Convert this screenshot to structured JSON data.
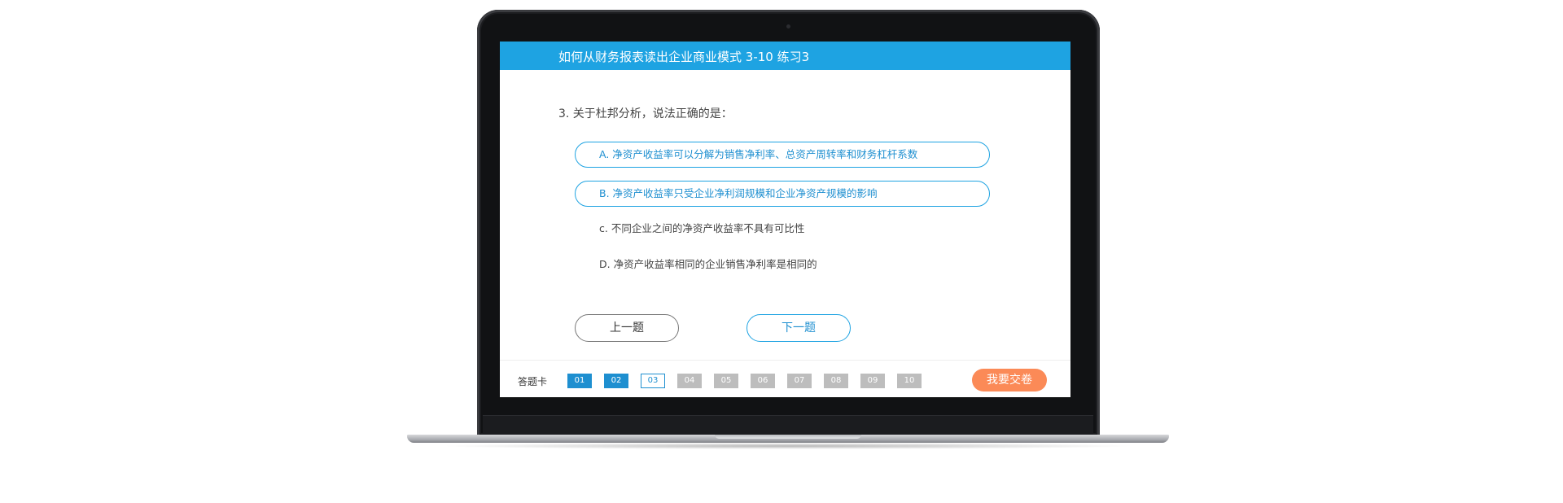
{
  "header": {
    "title": "如何从财务报表读出企业商业模式 3-10 练习3"
  },
  "question": {
    "text": "3. 关于杜邦分析，说法正确的是："
  },
  "options": [
    {
      "label": "A. 净资产收益率可以分解为销售净利率、总资产周转率和财务杠杆系数",
      "selected": true
    },
    {
      "label": "B. 净资产收益率只受企业净利润规模和企业净资产规模的影响",
      "selected": true
    },
    {
      "label": "c. 不同企业之间的净资产收益率不具有可比性",
      "selected": false
    },
    {
      "label": "D. 净资产收益率相同的企业销售净利率是相同的",
      "selected": false
    }
  ],
  "navigation": {
    "prev_label": "上一题",
    "next_label": "下一题"
  },
  "answer_card": {
    "label": "答题卡",
    "items": [
      {
        "num": "01",
        "state": "answered"
      },
      {
        "num": "02",
        "state": "answered"
      },
      {
        "num": "03",
        "state": "current"
      },
      {
        "num": "04",
        "state": "unanswered"
      },
      {
        "num": "05",
        "state": "unanswered"
      },
      {
        "num": "06",
        "state": "unanswered"
      },
      {
        "num": "07",
        "state": "unanswered"
      },
      {
        "num": "08",
        "state": "unanswered"
      },
      {
        "num": "09",
        "state": "unanswered"
      },
      {
        "num": "10",
        "state": "unanswered"
      }
    ],
    "submit_label": "我要交卷"
  },
  "colors": {
    "accent": "#1ea3e2",
    "answered": "#1e8fd0",
    "unanswered": "#bdbdbd",
    "submit": "#fb8a57"
  }
}
